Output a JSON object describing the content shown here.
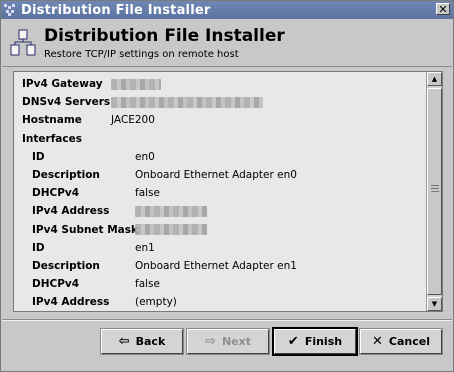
{
  "window": {
    "title": "Distribution File Installer",
    "close_glyph": "✕"
  },
  "header": {
    "title": "Distribution File Installer",
    "subtitle": "Restore TCP/IP settings on remote host"
  },
  "properties": [
    {
      "label": "IPv4 Gateway",
      "value": "",
      "redacted": true,
      "redact_w": 50,
      "level": 0
    },
    {
      "label": "DNSv4 Servers",
      "value": "",
      "redacted": true,
      "redact_w": 152,
      "level": 0
    },
    {
      "label": "Hostname",
      "value": "JACE200",
      "redacted": false,
      "level": 0
    },
    {
      "label": "Interfaces",
      "value": "",
      "redacted": false,
      "level": 0
    },
    {
      "label": "ID",
      "value": "en0",
      "redacted": false,
      "level": 1
    },
    {
      "label": "Description",
      "value": "Onboard Ethernet Adapter en0",
      "redacted": false,
      "level": 1
    },
    {
      "label": "DHCPv4",
      "value": "false",
      "redacted": false,
      "level": 1
    },
    {
      "label": "IPv4 Address",
      "value": "",
      "redacted": true,
      "redact_w": 72,
      "level": 1
    },
    {
      "label": "IPv4 Subnet Mask",
      "value": "",
      "redacted": true,
      "redact_w": 72,
      "level": 1
    },
    {
      "label": "ID",
      "value": "en1",
      "redacted": false,
      "level": 1
    },
    {
      "label": "Description",
      "value": "Onboard Ethernet Adapter en1",
      "redacted": false,
      "level": 1
    },
    {
      "label": "DHCPv4",
      "value": "false",
      "redacted": false,
      "level": 1
    },
    {
      "label": "IPv4 Address",
      "value": "(empty)",
      "redacted": false,
      "level": 1
    }
  ],
  "buttons": {
    "back": {
      "label": "Back",
      "enabled": true
    },
    "next": {
      "label": "Next",
      "enabled": false
    },
    "finish": {
      "label": "Finish",
      "enabled": true
    },
    "cancel": {
      "label": "Cancel",
      "enabled": true
    }
  },
  "colors": {
    "titlebar": "#6f88b3",
    "panel_bg": "#e8e8e8",
    "window_bg": "#c8c8c8"
  }
}
